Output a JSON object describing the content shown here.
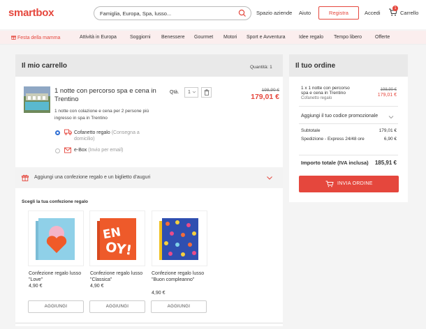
{
  "header": {
    "logo": "smartbox",
    "search_value": "Famiglia, Europa, Spa, lusso...",
    "links": [
      "Spazio aziende",
      "Aiuto"
    ],
    "register_label": "Registra",
    "login_label": "Accedi",
    "cart_label": "Carrello",
    "cart_count": "1"
  },
  "nav": {
    "items": [
      "Festa della mamma",
      "Attività in Europa",
      "Soggiorni",
      "Benessere",
      "Gourmet",
      "Motori",
      "Sport e Avventura",
      "Idee regalo",
      "Tempo libero",
      "Offerte"
    ]
  },
  "cart": {
    "title": "Il mio carrello",
    "quantity_label": "Quantità: 1",
    "product": {
      "title": "1 notte con percorso spa e cena in Trentino",
      "description": "1 notte con colazione e cena per 2 persone più ingresso in spa in Trentino",
      "qty_label": "Qtà.",
      "qty_value": "1",
      "old_price": "198,90 €",
      "price": "179,01 €"
    },
    "delivery": [
      {
        "label": "Cofanetto regalo",
        "sub": "(Consegna a domicilio)",
        "selected": true,
        "icon": "truck-icon"
      },
      {
        "label": "e-Box",
        "sub": "(Invio per email)",
        "selected": false,
        "icon": "envelope-icon"
      }
    ],
    "gift_bar": "Aggiungi una confezione regalo e un biglietto d'auguri",
    "gift_heading": "Scegli la tua confezione regalo",
    "gifts": [
      {
        "name": "Confezione regalo lusso \"Love\"",
        "price": "4,90 €",
        "button": "AGGIUNGI"
      },
      {
        "name": "Confezione regalo lusso \"Classica\"",
        "price": "4,90 €",
        "button": "AGGIUNGI"
      },
      {
        "name": "Confezione regalo lusso \"Buon compleanno\"",
        "price": "4,90 €",
        "button": "AGGIUNGI"
      }
    ]
  },
  "order": {
    "title": "Il tuo ordine",
    "item_line1": "1 x 1 notte con percorso",
    "item_line2": "spa e cena in Trentino",
    "item_sub": "Cofanetto regalo",
    "item_old_price": "198,90 €",
    "item_price": "179,01 €",
    "promo": "Aggiungi il tuo codice promozionale",
    "subtotal_label": "Subtotale",
    "subtotal_value": "179,01 €",
    "shipping_label": "Spedizione - Express 24/48 ore",
    "shipping_value": "6,90 €",
    "total_label": "Importo totale (IVA inclusa)",
    "total_value": "185,91 €",
    "submit_label": "INVIA ORDINE"
  },
  "colors": {
    "brand": "#e5473d",
    "nav_bg": "#fbeeee",
    "radio_selected": "#2f6fd4"
  }
}
